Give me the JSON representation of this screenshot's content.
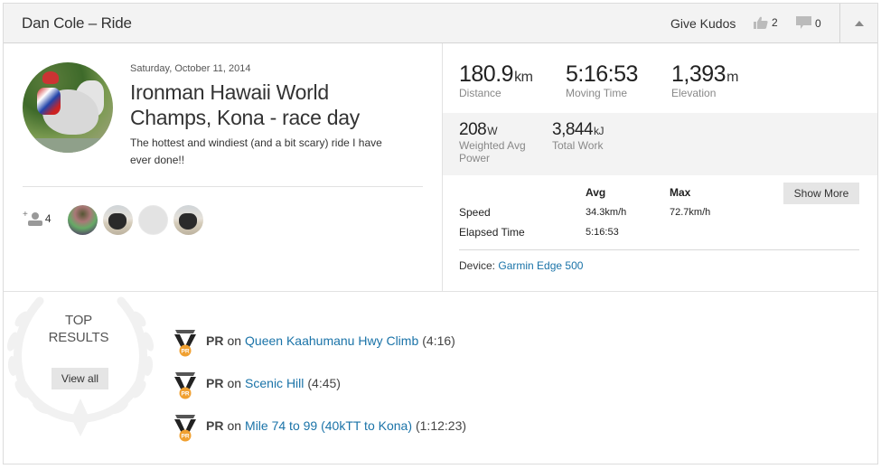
{
  "header": {
    "title": "Dan Cole – Ride",
    "give_kudos": "Give Kudos",
    "kudos_count": "2",
    "comment_count": "0",
    "collapse_icon": "chevron-up-icon"
  },
  "activity": {
    "date": "Saturday, October 11, 2014",
    "title": "Ironman Hawaii World Champs, Kona - race day",
    "description": "The hottest and windiest (and a bit scary) ride I have ever done!!",
    "group_count": "4",
    "group_plus": "+",
    "athletes": [
      "athlete-1",
      "athlete-2",
      "athlete-3",
      "athlete-4"
    ]
  },
  "stats": {
    "primary": [
      {
        "value": "180.9",
        "unit": "km",
        "label": "Distance"
      },
      {
        "value": "5:16:53",
        "unit": "",
        "label": "Moving Time"
      },
      {
        "value": "1,393",
        "unit": "m",
        "label": "Elevation"
      }
    ],
    "secondary": [
      {
        "value": "208",
        "unit": "W",
        "label": "Weighted Avg Power"
      },
      {
        "value": "3,844",
        "unit": "kJ",
        "label": "Total Work"
      }
    ],
    "table": {
      "headers": [
        "Avg",
        "Max"
      ],
      "rows": [
        {
          "label": "Speed",
          "avg": "34.3km/h",
          "max": "72.7km/h"
        },
        {
          "label": "Elapsed Time",
          "avg": "5:16:53",
          "max": ""
        }
      ]
    },
    "show_more": "Show More",
    "device_label": "Device:",
    "device_name": "Garmin Edge 500"
  },
  "top_results": {
    "title_line1": "TOP",
    "title_line2": "RESULTS",
    "view_all": "View all",
    "items": [
      {
        "badge": "PR",
        "on": "on",
        "segment": "Queen Kaahumanu Hwy Climb",
        "time": "(4:16)"
      },
      {
        "badge": "PR",
        "on": "on",
        "segment": "Scenic Hill",
        "time": "(4:45)"
      },
      {
        "badge": "PR",
        "on": "on",
        "segment": "Mile 74 to 99 (40kTT to Kona)",
        "time": "(1:12:23)"
      }
    ],
    "medal_label": "PR"
  }
}
